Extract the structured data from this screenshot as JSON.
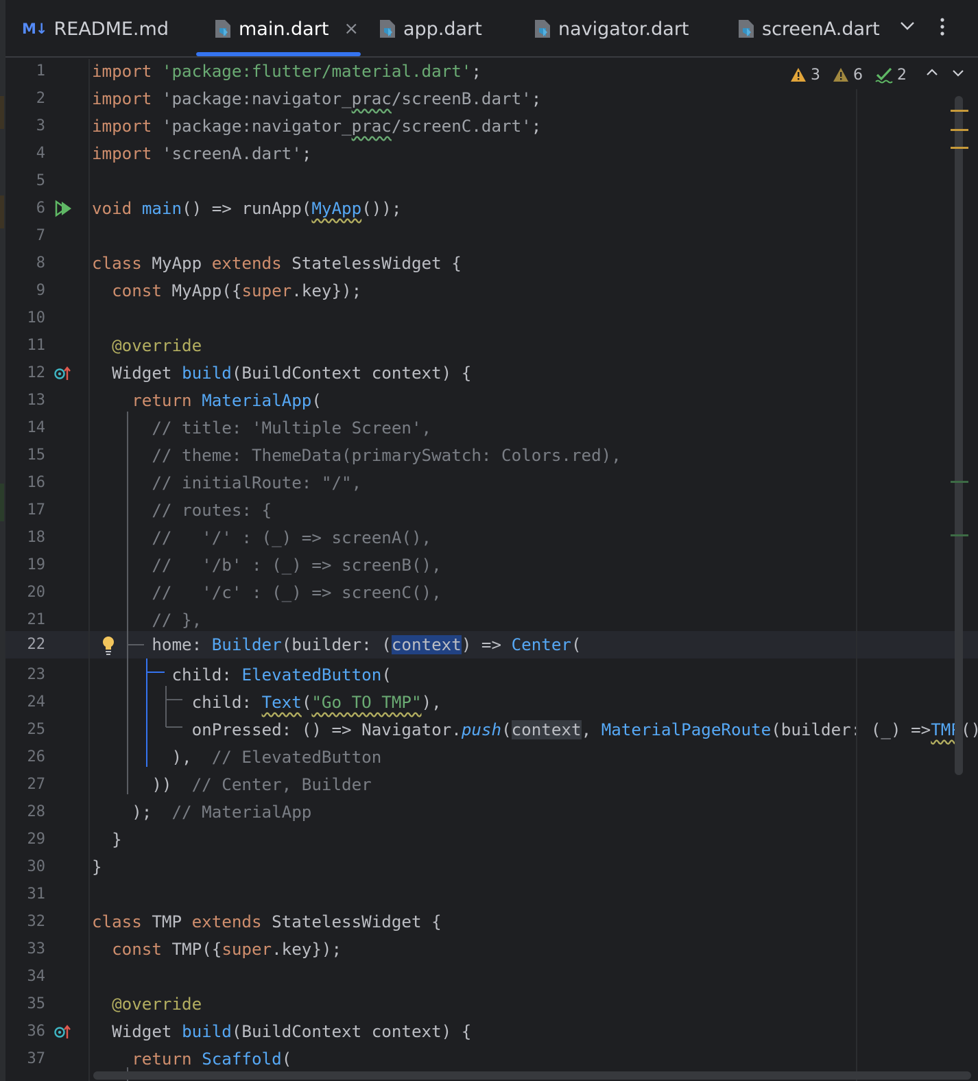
{
  "tabs": [
    {
      "label": "README.md",
      "type": "markdown",
      "active": false
    },
    {
      "label": "main.dart",
      "type": "dart",
      "active": true
    },
    {
      "label": "app.dart",
      "type": "dart",
      "active": false
    },
    {
      "label": "navigator.dart",
      "type": "dart",
      "active": false
    },
    {
      "label": "screenA.dart",
      "type": "dart",
      "active": false
    }
  ],
  "tab_icons": {
    "markdown": "M↓",
    "close": "×",
    "more_tabs": "chevron-down-icon",
    "menu": "kebab-menu-icon"
  },
  "inspections": {
    "warnings": "3",
    "weak_warnings": "6",
    "typos": "2"
  },
  "colors": {
    "accent": "#3574f0",
    "keyword": "#cf8e6d",
    "string": "#6aab73",
    "class": "#56a8f5",
    "comment": "#7a7e85",
    "annotation": "#b3ae60",
    "selection": "#214283",
    "warning": "#e2a53a"
  },
  "current_line": 22,
  "line_numbers": [
    "1",
    "2",
    "3",
    "4",
    "5",
    "6",
    "7",
    "8",
    "9",
    "10",
    "11",
    "12",
    "13",
    "14",
    "15",
    "16",
    "17",
    "18",
    "19",
    "20",
    "21",
    "22",
    "23",
    "24",
    "25",
    "26",
    "27",
    "28",
    "29",
    "30",
    "31",
    "32",
    "33",
    "34",
    "35",
    "36",
    "37"
  ],
  "code": {
    "l1": [
      "import",
      " ",
      "'package:flutter/material.dart'",
      ";"
    ],
    "l2": [
      "import",
      " ",
      "'package:navigator_",
      "prac",
      "/screenB.dart'",
      ";"
    ],
    "l3": [
      "import",
      " ",
      "'package:navigator_",
      "prac",
      "/screenC.dart'",
      ";"
    ],
    "l4": [
      "import",
      " ",
      "'screenA.dart'",
      ";"
    ],
    "l6": [
      "void",
      " ",
      "main",
      "() => runApp(",
      "MyApp",
      "());"
    ],
    "l8": [
      "class",
      " MyApp ",
      "extends",
      " StatelessWidget {"
    ],
    "l9": [
      "  ",
      "const",
      " MyApp({",
      "super",
      ".key});"
    ],
    "l11": [
      "  ",
      "@override"
    ],
    "l12": [
      "  Widget ",
      "build",
      "(BuildContext context) {"
    ],
    "l13": [
      "    ",
      "return",
      " ",
      "MaterialApp",
      "("
    ],
    "l14": "      // title: 'Multiple Screen',",
    "l15": "      // theme: ThemeData(primarySwatch: Colors.red),",
    "l16": "      // initialRoute: \"/\",",
    "l17": "      // routes: {",
    "l18": "      //   '/' : (_) => screenA(),",
    "l19": "      //   '/b' : (_) => screenB(),",
    "l20": "      //   '/c' : (_) => screenC(),",
    "l21": "      // },",
    "l22": [
      "      home: ",
      "Builder",
      "(builder: (",
      "context",
      ") => ",
      "Center",
      "("
    ],
    "l23": [
      "        child: ",
      "ElevatedButton",
      "("
    ],
    "l24": [
      "          child: ",
      "Text",
      "(",
      "\"Go TO TMP\"",
      "),"
    ],
    "l25": [
      "          onPressed: () => Navigator.",
      "push",
      "(",
      "context",
      ", ",
      "MaterialPageRoute",
      "(builder: (_) =>",
      "TMP",
      "())),"
    ],
    "l26": [
      "        ),  ",
      "// ElevatedButton"
    ],
    "l27": [
      "      ))  ",
      "// Center, Builder"
    ],
    "l28": [
      "    );  ",
      "// MaterialApp"
    ],
    "l29": "  }",
    "l30": "}",
    "l32": [
      "class",
      " TMP ",
      "extends",
      " StatelessWidget {"
    ],
    "l33": [
      "  ",
      "const",
      " TMP({",
      "super",
      ".key});"
    ],
    "l35": [
      "  ",
      "@override"
    ],
    "l36": [
      "  Widget ",
      "build",
      "(BuildContext context) {"
    ],
    "l37": [
      "    ",
      "return",
      " ",
      "Scaffold",
      "("
    ]
  }
}
